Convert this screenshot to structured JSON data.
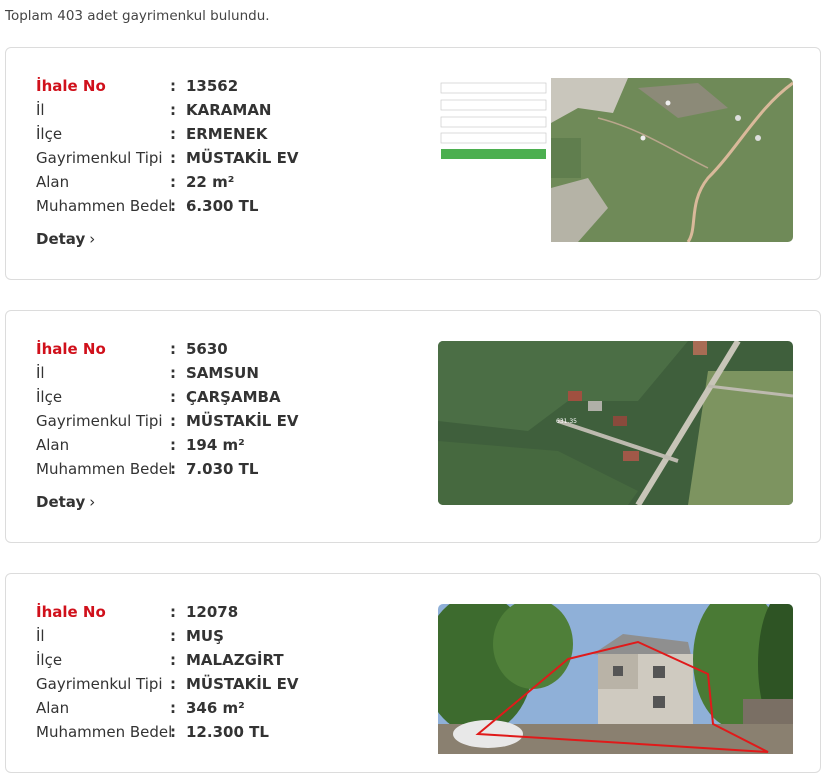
{
  "result_count_text": "Toplam 403 adet gayrimenkul bulundu.",
  "labels": {
    "ihale_no": "İhale No",
    "il": "İl",
    "ilce": "İlçe",
    "tip": "Gayrimenkul Tipi",
    "alan": "Alan",
    "bedel": "Muhammen Bedel",
    "colon": ":",
    "detail": "Detay",
    "detail_chevron": "›"
  },
  "listings": [
    {
      "ihale_no": "13562",
      "il": "KARAMAN",
      "ilce": "ERMENEK",
      "tip": "MÜSTAKİL EV",
      "alan": "22 m²",
      "bedel": "6.300 TL",
      "image_icon": "satellite-map-with-form-image"
    },
    {
      "ihale_no": "5630",
      "il": "SAMSUN",
      "ilce": "ÇARŞAMBA",
      "tip": "MÜSTAKİL EV",
      "alan": "194 m²",
      "bedel": "7.030 TL",
      "image_icon": "satellite-map-image"
    },
    {
      "ihale_no": "12078",
      "il": "MUŞ",
      "ilce": "MALAZGİRT",
      "tip": "MÜSTAKİL EV",
      "alan": "346 m²",
      "bedel": "12.300 TL",
      "image_icon": "house-photo-image"
    }
  ],
  "colors": {
    "accent_red": "#d0101b",
    "text": "#333333",
    "border": "#dcdcdc"
  }
}
